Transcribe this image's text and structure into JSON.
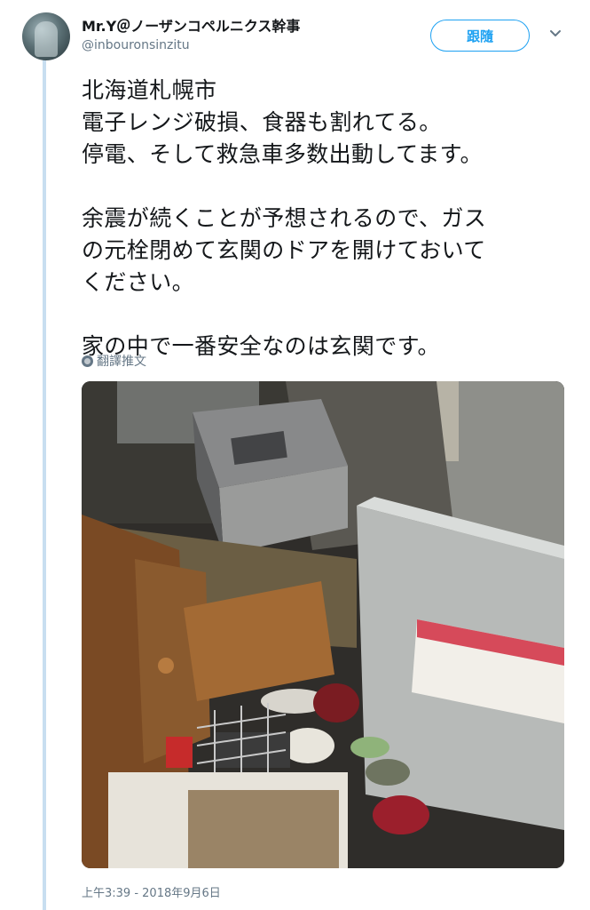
{
  "author": {
    "name": "Mr.Y＠ノーザンコペルニクス幹事",
    "handle": "@inbouronsinzitu"
  },
  "follow_label": "跟隨",
  "tweet": {
    "paragraphs": [
      "北海道札幌市\n電子レンジ破損、食器も割れてる。\n停電、そして救急車多数出動してます。",
      "余震が続くことが予想されるので、ガス\nの元栓閉めて玄関のドアを開けておいて\nください。",
      "家の中で一番安全なのは玄関です。"
    ]
  },
  "translate_label": "翻譯推文",
  "photo_label": "",
  "timestamp": "上午3:39 - 2018年9月6日",
  "colors": {
    "accent": "#1da1f2",
    "thread_line": "#c8def0",
    "secondary_text": "#657786"
  }
}
